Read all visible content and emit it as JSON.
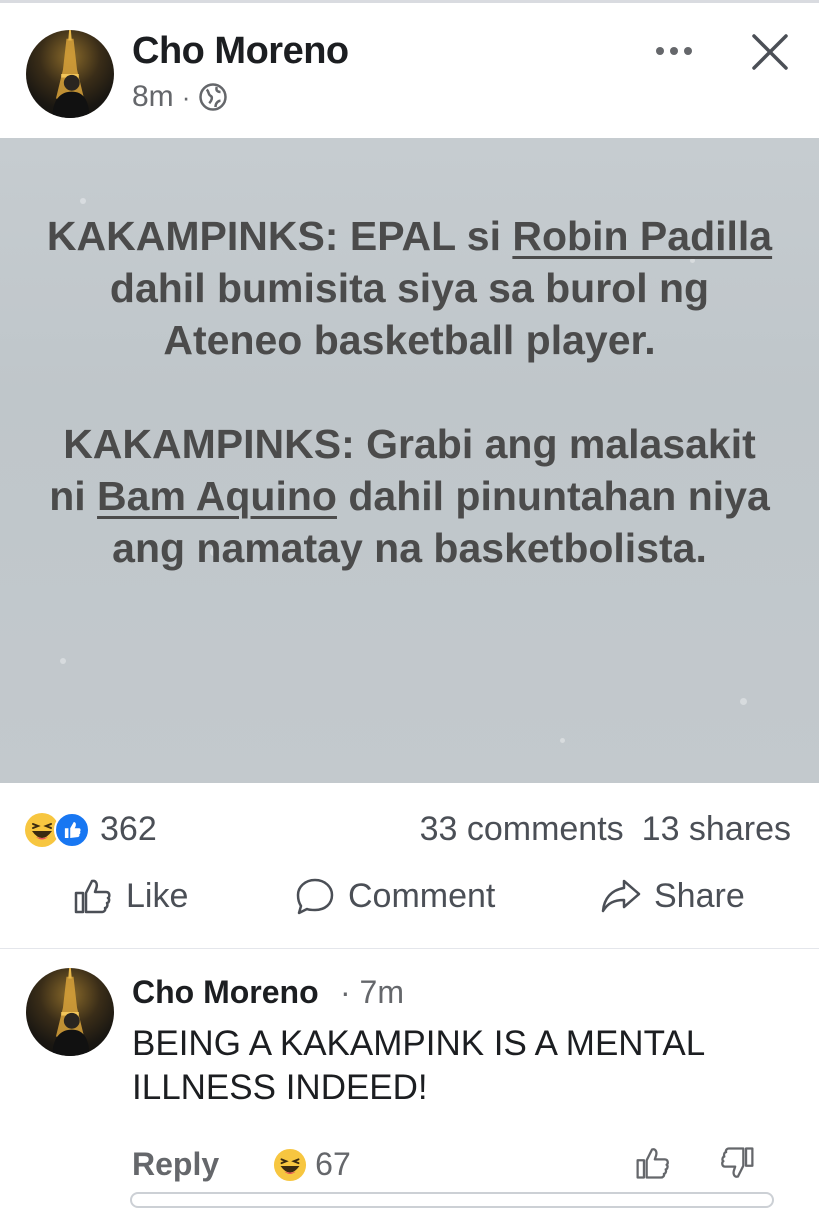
{
  "post": {
    "author": "Cho Moreno",
    "time": "8m",
    "separator": "·",
    "image_text": {
      "paragraph1_prefix": "KAKAMPINKS: EPAL si ",
      "paragraph1_tag": "Robin Padilla",
      "paragraph1_suffix": " dahil bumisita siya sa burol ng Ateneo basketball player.",
      "paragraph2_prefix": "KAKAMPINKS: Grabi ang malasakit ni ",
      "paragraph2_tag": "Bam Aquino",
      "paragraph2_suffix": " dahil pinuntahan niya ang namatay na basketbolista."
    },
    "reaction_count": "362",
    "comments": "33 comments",
    "shares": "13 shares",
    "actions": {
      "like": "Like",
      "comment": "Comment",
      "share": "Share"
    }
  },
  "comment": {
    "author": "Cho Moreno",
    "time": "· 7m",
    "text": "BEING A KAKAMPINK IS A MENTAL ILLNESS INDEED!",
    "reply": "Reply",
    "reaction_count": "67"
  },
  "colors": {
    "like_blue": "#1877f2",
    "haha_yellow": "#f7c640",
    "muted_text": "#65676b",
    "image_text": "#4b4b4b"
  },
  "icons": [
    "globe-icon",
    "more-icon",
    "close-icon",
    "haha-reaction-icon",
    "like-reaction-icon",
    "like-icon",
    "comment-icon",
    "share-icon",
    "dislike-icon"
  ]
}
